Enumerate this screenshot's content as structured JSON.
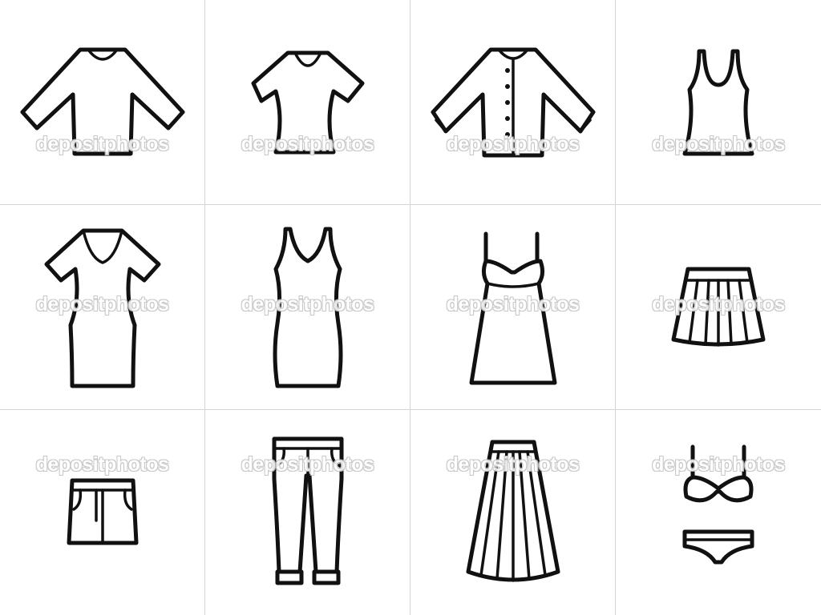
{
  "watermark": "depositphotos",
  "icons": [
    {
      "name": "long-sleeve-shirt-icon"
    },
    {
      "name": "short-sleeve-tshirt-icon"
    },
    {
      "name": "button-cardigan-icon"
    },
    {
      "name": "tank-top-icon"
    },
    {
      "name": "short-sleeve-dress-icon"
    },
    {
      "name": "sleeveless-dress-icon"
    },
    {
      "name": "slip-dress-icon"
    },
    {
      "name": "pleated-mini-skirt-icon"
    },
    {
      "name": "denim-mini-skirt-icon"
    },
    {
      "name": "jeans-icon"
    },
    {
      "name": "long-pleated-skirt-icon"
    },
    {
      "name": "bikini-icon"
    }
  ],
  "colors": {
    "outline": "#111111",
    "background": "#ffffff",
    "grid_line": "#d4d4d4",
    "watermark": "#c4c4c4"
  }
}
